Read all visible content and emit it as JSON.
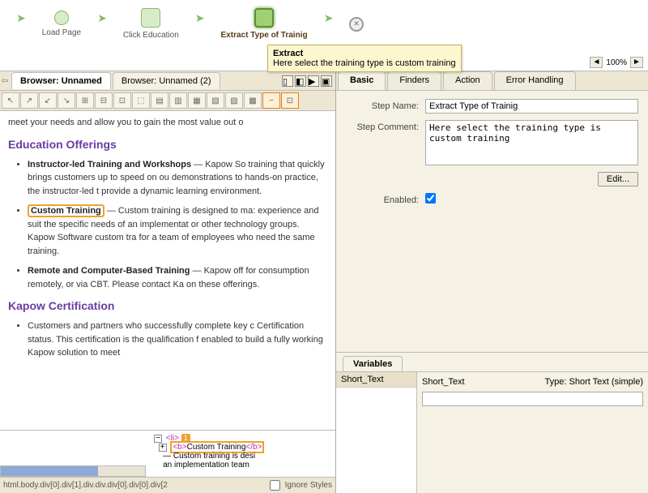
{
  "workflow": {
    "nodes": [
      "Load Page",
      "Click Education",
      "Extract Type of Trainig"
    ],
    "tooltip_title": "Extract",
    "tooltip_body": "Here select the training type is custom training"
  },
  "zoom": {
    "value": "100%"
  },
  "browser_tabs": {
    "active": "Browser: Unnamed",
    "second": "Browser: Unnamed (2)"
  },
  "content": {
    "intro": "meet your needs and allow you to gain the most value out o",
    "h1": "Education Offerings",
    "li1_b": "Instructor-led Training and Workshops",
    "li1_t": " — Kapow So           training that quickly brings customers up to speed on ou demonstrations to hands-on practice, the instructor-led t provide a dynamic learning environment.",
    "li2_b": "Custom Training",
    "li2_t": " — Custom training is designed to ma: experience and suit the specific needs of an implementat or other technology groups. Kapow Software custom tra for a team of employees who need the same training.",
    "li3_b": "Remote and Computer-Based Training",
    "li3_t": " — Kapow off for consumption remotely, or via CBT. Please contact Ka on these offerings.",
    "h2": "Kapow Certification",
    "li4_t": "Customers and partners who successfully complete key c Certification status. This certification is the qualification f enabled to build a fully working Kapow solution to meet"
  },
  "dom": {
    "li_tag": "<li>",
    "badge": "1",
    "b_open": "<b>",
    "b_text": "Custom Training",
    "b_close": "</b>",
    "desc": "— Custom training is desi",
    "desc2": "an implementation team"
  },
  "breadcrumb": {
    "path": "html.body.div[0].div[1].div.div.div[0].div[0].div[2",
    "ignore_styles": "Ignore Styles"
  },
  "right_tabs": [
    "Basic",
    "Finders",
    "Action",
    "Error Handling"
  ],
  "form": {
    "step_name_label": "Step Name:",
    "step_name_value": "Extract Type of Trainig",
    "step_comment_label": "Step Comment:",
    "step_comment_value": "Here select the training type is custom training",
    "edit": "Edit...",
    "enabled_label": "Enabled:"
  },
  "variables": {
    "tab": "Variables",
    "item": "Short_Text",
    "name": "Short_Text",
    "type_label": "Type:",
    "type_value": "Short Text (simple)"
  }
}
